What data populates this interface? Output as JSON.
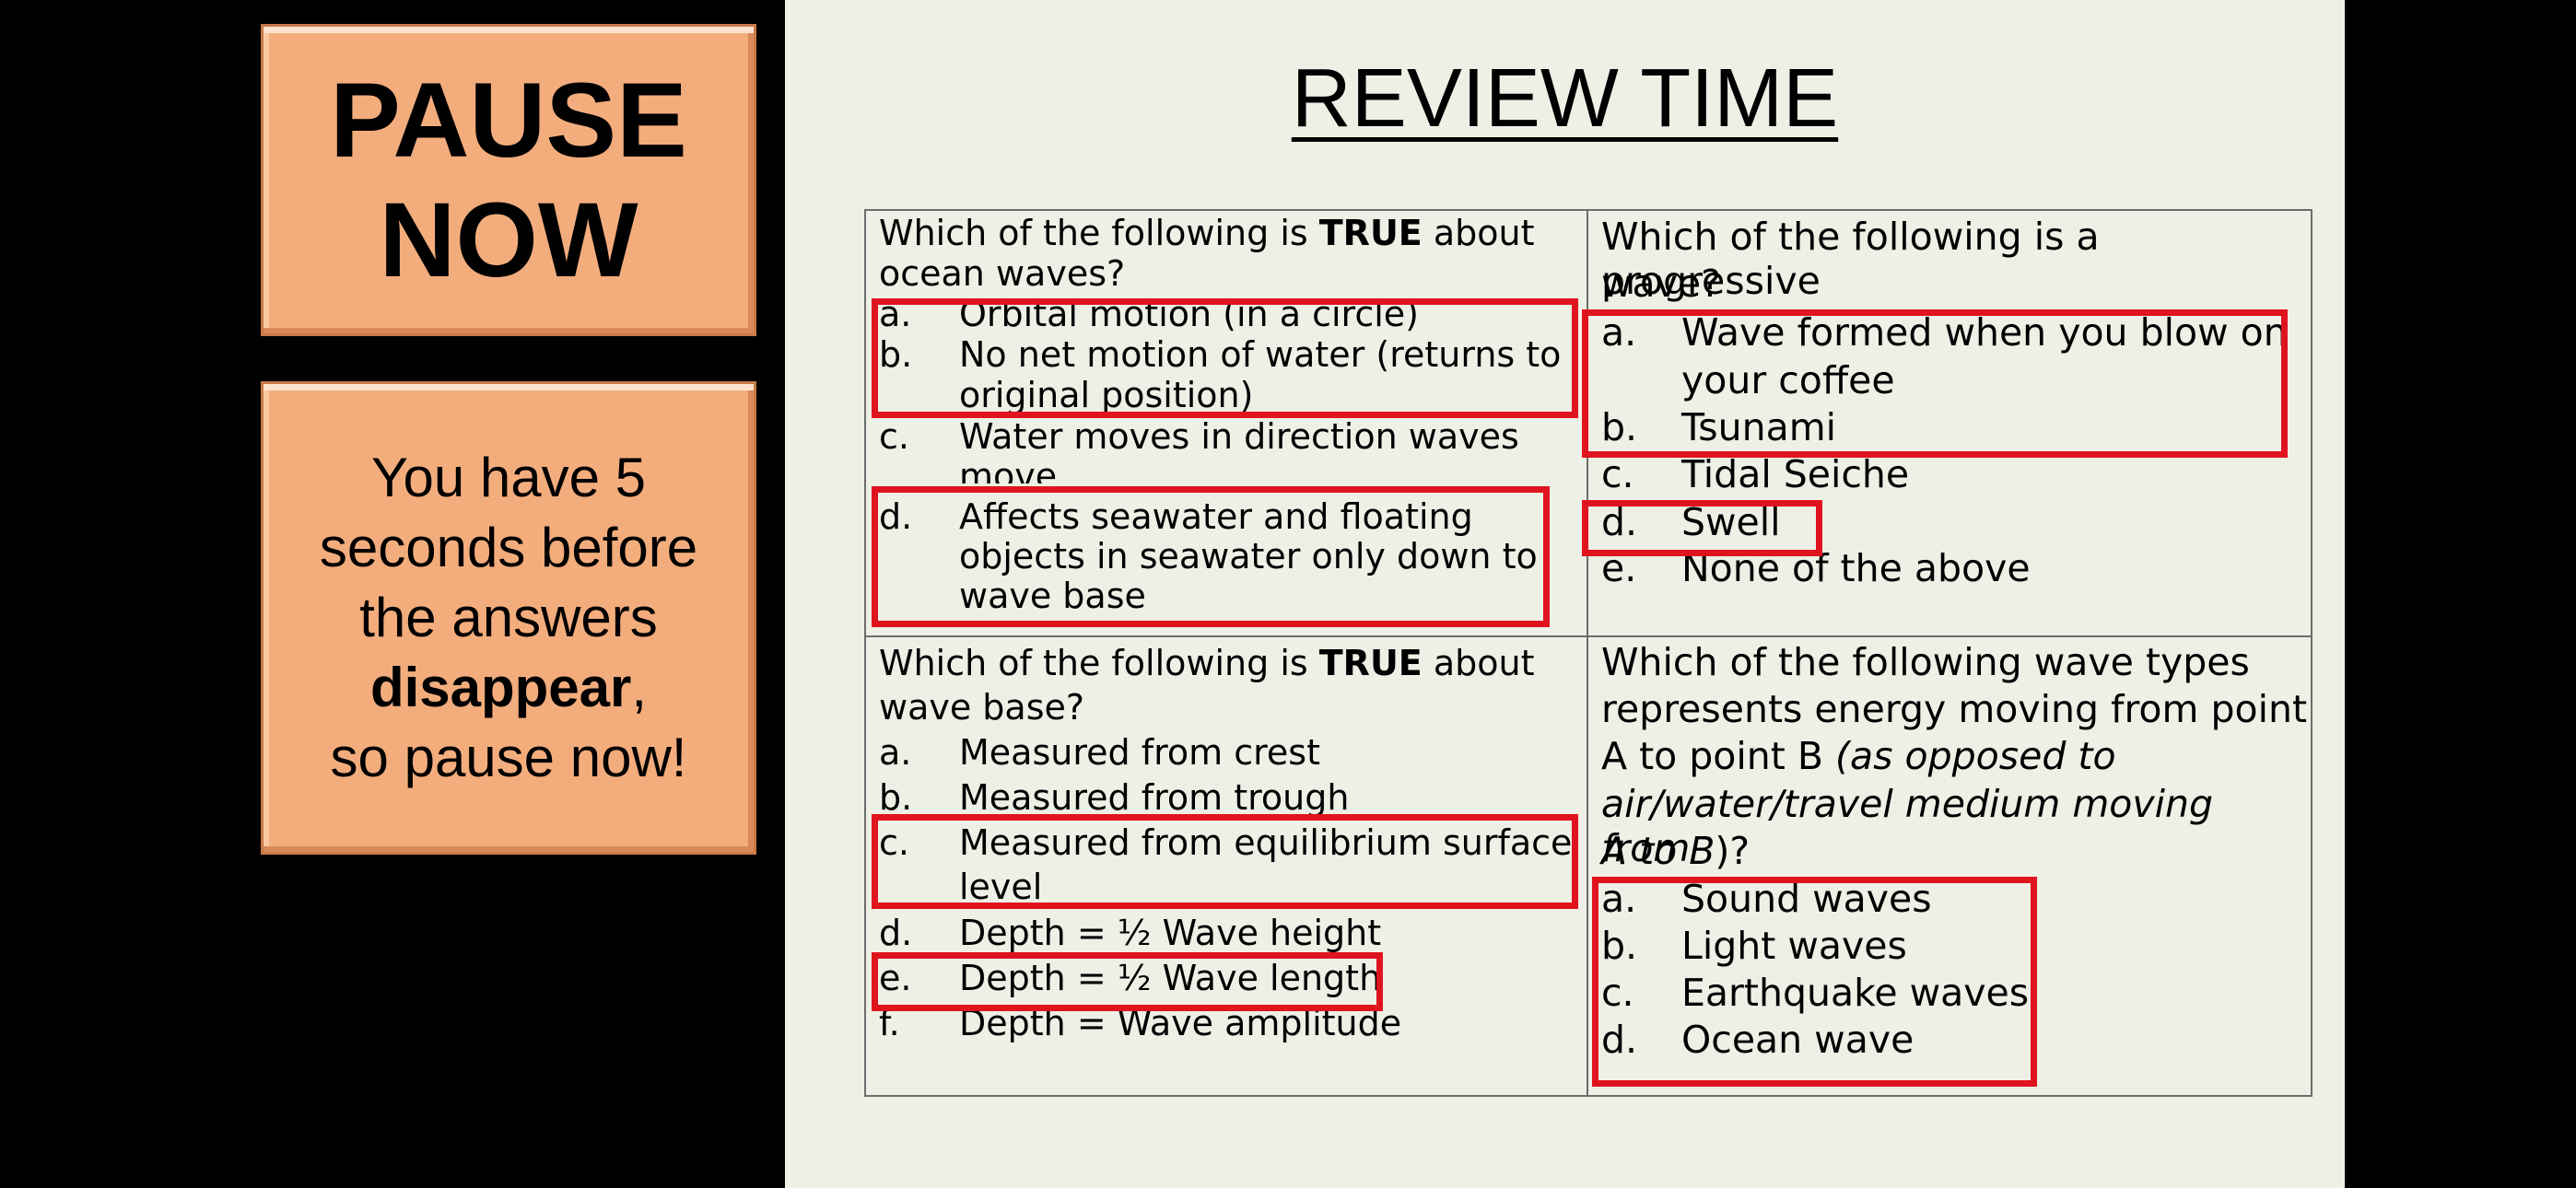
{
  "side": {
    "pause_line1": "PAUSE",
    "pause_line2": "NOW",
    "timer_line1": "You have 5",
    "timer_line2": "seconds before",
    "timer_line3": "the answers",
    "timer_bold": "disappear",
    "timer_comma": ",",
    "timer_line5": "so pause now!"
  },
  "slide": {
    "title": "REVIEW TIME",
    "q1": {
      "pre": "Which of the following is ",
      "bold": "TRUE",
      "post_line1": " about",
      "line2": "ocean waves?",
      "options": [
        {
          "letter": "a.",
          "lines": [
            "Orbital motion (in a circle)"
          ]
        },
        {
          "letter": "b.",
          "lines": [
            "No net motion of water (returns to",
            "original position)"
          ]
        },
        {
          "letter": "c.",
          "lines": [
            "Water moves in direction waves",
            "move"
          ]
        },
        {
          "letter": "d.",
          "lines": [
            "Affects seawater and floating",
            "objects in seawater only down to",
            "wave base"
          ]
        }
      ]
    },
    "q2": {
      "line1": "Which of the following is a progressive",
      "line2": "wave?",
      "options": [
        {
          "letter": "a.",
          "lines": [
            "Wave formed when you blow on",
            "your coffee"
          ]
        },
        {
          "letter": "b.",
          "lines": [
            "Tsunami"
          ]
        },
        {
          "letter": "c.",
          "lines": [
            "Tidal Seiche"
          ]
        },
        {
          "letter": "d.",
          "lines": [
            "Swell"
          ]
        },
        {
          "letter": "e.",
          "lines": [
            "None of the above"
          ]
        }
      ]
    },
    "q3": {
      "pre": "Which of the following is ",
      "bold": "TRUE",
      "post_line1": " about",
      "line2": "wave base?",
      "options": [
        {
          "letter": "a.",
          "lines": [
            "Measured from crest"
          ]
        },
        {
          "letter": "b.",
          "lines": [
            "Measured from trough"
          ]
        },
        {
          "letter": "c.",
          "lines": [
            "Measured from equilibrium surface",
            "level"
          ]
        },
        {
          "letter": "d.",
          "lines": [
            "Depth = ½ Wave height"
          ]
        },
        {
          "letter": "e.",
          "lines": [
            "Depth = ½ Wave length"
          ]
        },
        {
          "letter": "f.",
          "lines": [
            "Depth = Wave amplitude"
          ]
        }
      ]
    },
    "q4": {
      "line1": "Which of the following wave types",
      "line2": "represents energy moving from point",
      "line3_plain": "A to point B ",
      "line3_italic": "(as opposed to",
      "line4_italic": "air/water/travel medium moving from",
      "line5_italic": "A to B",
      "line5_plain": ")?",
      "options": [
        {
          "letter": "a.",
          "lines": [
            "Sound waves"
          ]
        },
        {
          "letter": "b.",
          "lines": [
            "Light waves"
          ]
        },
        {
          "letter": "c.",
          "lines": [
            "Earthquake waves"
          ]
        },
        {
          "letter": "d.",
          "lines": [
            "Ocean wave"
          ]
        }
      ]
    },
    "highlight_color": "#e0141e"
  }
}
